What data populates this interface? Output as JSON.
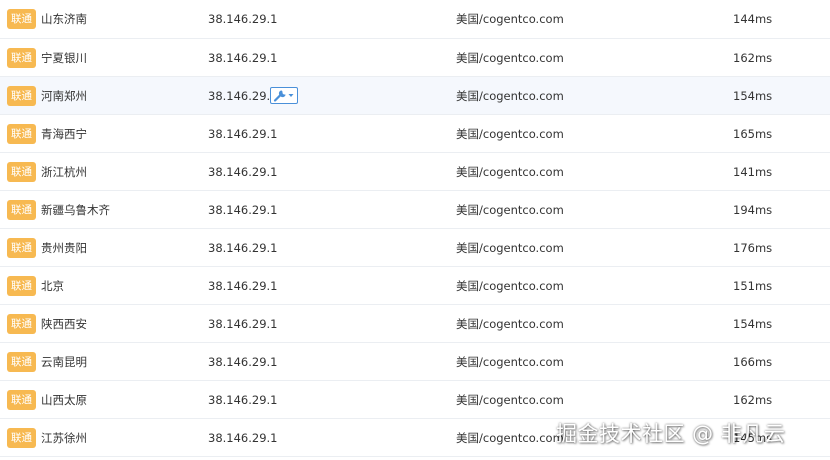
{
  "rows": [
    {
      "carrier": "联通",
      "location": "山东济南",
      "ip": "38.146.29.1",
      "isp": "美国/cogentco.com",
      "latency": "144ms"
    },
    {
      "carrier": "联通",
      "location": "宁夏银川",
      "ip": "38.146.29.1",
      "isp": "美国/cogentco.com",
      "latency": "162ms"
    },
    {
      "carrier": "联通",
      "location": "河南郑州",
      "ip": "38.146.29.1",
      "isp": "美国/cogentco.com",
      "latency": "154ms"
    },
    {
      "carrier": "联通",
      "location": "青海西宁",
      "ip": "38.146.29.1",
      "isp": "美国/cogentco.com",
      "latency": "165ms"
    },
    {
      "carrier": "联通",
      "location": "浙江杭州",
      "ip": "38.146.29.1",
      "isp": "美国/cogentco.com",
      "latency": "141ms"
    },
    {
      "carrier": "联通",
      "location": "新疆乌鲁木齐",
      "ip": "38.146.29.1",
      "isp": "美国/cogentco.com",
      "latency": "194ms"
    },
    {
      "carrier": "联通",
      "location": "贵州贵阳",
      "ip": "38.146.29.1",
      "isp": "美国/cogentco.com",
      "latency": "176ms"
    },
    {
      "carrier": "联通",
      "location": "北京",
      "ip": "38.146.29.1",
      "isp": "美国/cogentco.com",
      "latency": "151ms"
    },
    {
      "carrier": "联通",
      "location": "陕西西安",
      "ip": "38.146.29.1",
      "isp": "美国/cogentco.com",
      "latency": "154ms"
    },
    {
      "carrier": "联通",
      "location": "云南昆明",
      "ip": "38.146.29.1",
      "isp": "美国/cogentco.com",
      "latency": "166ms"
    },
    {
      "carrier": "联通",
      "location": "山西太原",
      "ip": "38.146.29.1",
      "isp": "美国/cogentco.com",
      "latency": "162ms"
    },
    {
      "carrier": "联通",
      "location": "江苏徐州",
      "ip": "38.146.29.1",
      "isp": "美国/cogentco.com",
      "latency": "145ms"
    }
  ],
  "tool_dropdown": {
    "icon": "wrench-icon",
    "caret": "caret-down-icon"
  },
  "watermark": "掘金技术社区 @ 非凡云",
  "colors": {
    "badge": "#f7b951",
    "row_highlight": "#f5f8fd",
    "tool_accent": "#4a90d9"
  }
}
